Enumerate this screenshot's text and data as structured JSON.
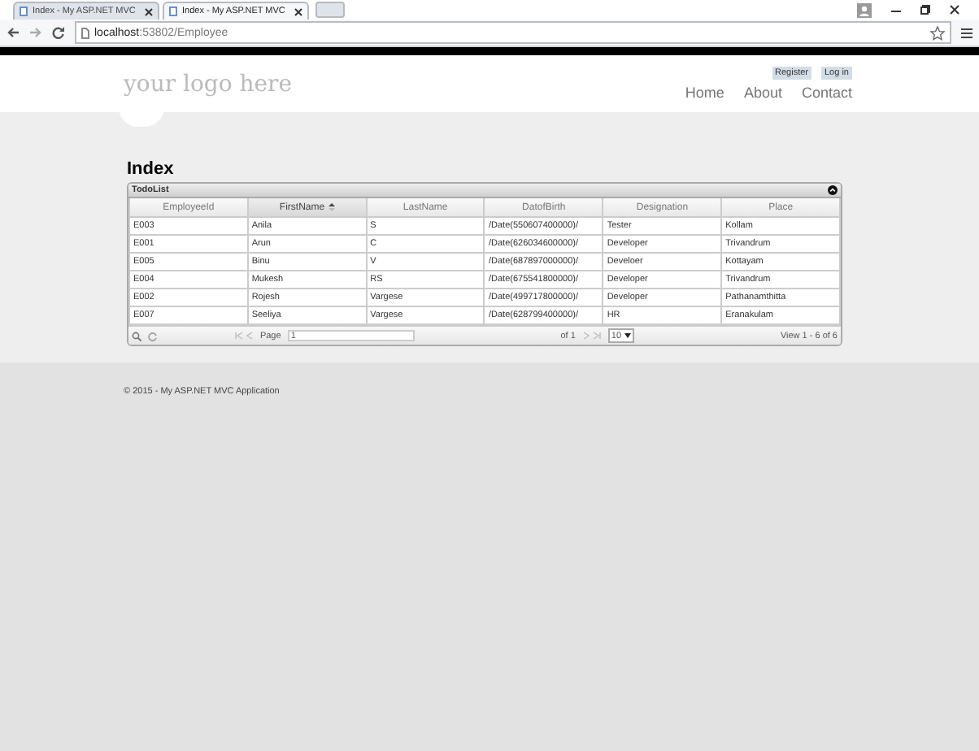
{
  "browser": {
    "tabs": [
      {
        "title": "Index - My ASP.NET MVC",
        "selected": false
      },
      {
        "title": "Index - My ASP.NET MVC",
        "selected": true
      }
    ],
    "url_host": "localhost",
    "url_rest": ":53802/Employee"
  },
  "header": {
    "logo": "your logo here",
    "account_links": [
      "Register",
      "Log in"
    ],
    "nav": [
      "Home",
      "About",
      "Contact"
    ]
  },
  "page_title": "Index",
  "grid": {
    "caption": "TodoList",
    "columns": [
      {
        "label": "EmployeeId",
        "sorted": false
      },
      {
        "label": "FirstName",
        "sorted": true
      },
      {
        "label": "LastName",
        "sorted": false
      },
      {
        "label": "DatofBirth",
        "sorted": false
      },
      {
        "label": "Designation",
        "sorted": false
      },
      {
        "label": "Place",
        "sorted": false
      }
    ],
    "rows": [
      [
        "E003",
        "Anila",
        "S",
        "/Date(550607400000)/",
        "Tester",
        "Kollam"
      ],
      [
        "E001",
        "Arun",
        "C",
        "/Date(626034600000)/",
        "Developer",
        "Trivandrum"
      ],
      [
        "E005",
        "Binu",
        "V",
        "/Date(687897000000)/",
        "Develoer",
        "Kottayam"
      ],
      [
        "E004",
        "Mukesh",
        "RS",
        "/Date(675541800000)/",
        "Developer",
        "Trivandrum"
      ],
      [
        "E002",
        "Rojesh",
        "Vargese",
        "/Date(499717800000)/",
        "Developer",
        "Pathanamthitta"
      ],
      [
        "E007",
        "Seeliya",
        "Vargese",
        "/Date(628799400000)/",
        "HR",
        "Eranakulam"
      ]
    ],
    "pager": {
      "page_label": "Page",
      "page_value": "1",
      "of_pages": "of 1",
      "page_size": "10",
      "view_info": "View 1 - 6 of 6"
    }
  },
  "footer": "© 2015 - My ASP.NET MVC Application"
}
